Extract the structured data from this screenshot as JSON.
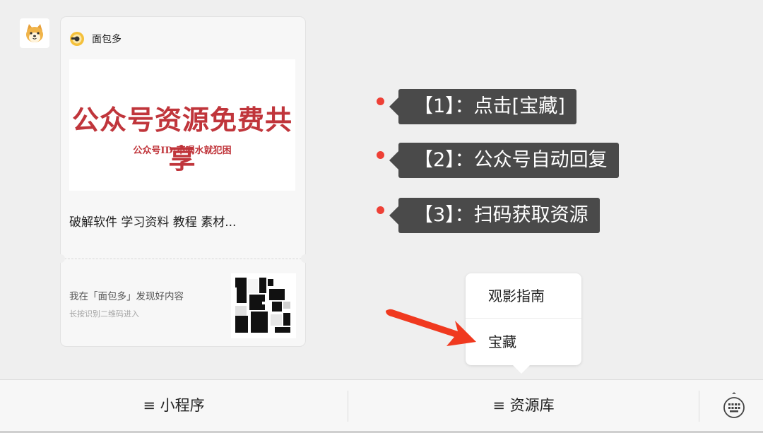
{
  "chat": {
    "avatar_icon": "shiba-dog-avatar-icon",
    "card": {
      "app_icon": "bread-logo-icon",
      "app_name": "面包多",
      "banner_title": "公众号资源免费共享",
      "banner_subtitle": "公众号ID:不喝水就犯困",
      "description": "破解软件 学习资料 教程 素材...",
      "found_text": "我在「面包多」发现好内容",
      "hint_text": "长按识别二维码进入",
      "qr_icon": "qr-code-icon"
    }
  },
  "steps": [
    {
      "label": "【1】：点击[宝藏]"
    },
    {
      "label": "【2】：公众号自动回复"
    },
    {
      "label": "【3】：扫码获取资源"
    }
  ],
  "popup_menu": {
    "items": [
      {
        "label": "观影指南"
      },
      {
        "label": "宝藏"
      }
    ]
  },
  "annotation": {
    "arrow_icon": "red-arrow-icon",
    "color": "#f0391f"
  },
  "bottom_bar": {
    "items": [
      {
        "label": "≡ 小程序"
      },
      {
        "label": "≡ 资源库"
      }
    ],
    "keyboard_icon": "keyboard-icon"
  },
  "colors": {
    "step_dot": "#ee4036",
    "step_tag_bg": "#4a4a4a",
    "banner_text": "#c0353b",
    "background": "#efefef"
  }
}
